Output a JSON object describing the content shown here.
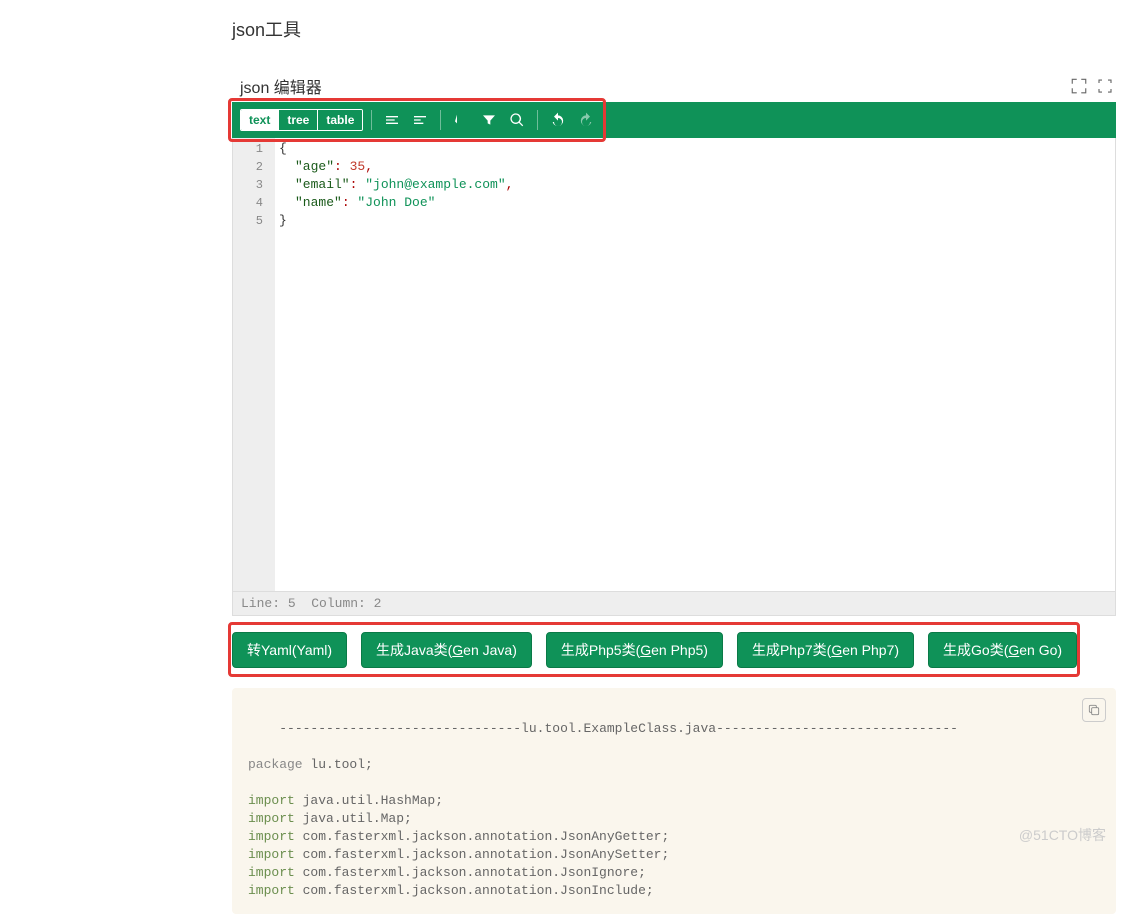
{
  "page_title": "json工具",
  "editor": {
    "title": "json 编辑器",
    "modes": {
      "text": "text",
      "tree": "tree",
      "table": "table",
      "active": "text"
    },
    "lines": [
      {
        "n": 1,
        "type": "brace-open",
        "text": "{"
      },
      {
        "n": 2,
        "type": "prop-num",
        "key": "\"age\"",
        "val": "35"
      },
      {
        "n": 3,
        "type": "prop-str",
        "key": "\"email\"",
        "val": "\"john@example.com\""
      },
      {
        "n": 4,
        "type": "prop-str-last",
        "key": "\"name\"",
        "val": "\"John Doe\""
      },
      {
        "n": 5,
        "type": "brace-close",
        "text": "}"
      }
    ],
    "status": {
      "line_label": "Line:",
      "line": "5",
      "col_label": "Column:",
      "col": "2"
    }
  },
  "actions": {
    "yaml": "转Yaml(Yaml)",
    "java_pre": "生成Java类(",
    "java_u": "G",
    "java_post": "en Java)",
    "php5_pre": "生成Php5类(",
    "php5_u": "G",
    "php5_post": "en Php5)",
    "php7_pre": "生成Php7类(",
    "php7_u": "G",
    "php7_post": "en Php7)",
    "go_pre": "生成Go类(",
    "go_u": "G",
    "go_post": "en Go)"
  },
  "output": {
    "header": "-------------------------------lu.tool.ExampleClass.java-------------------------------",
    "package_kw": "package",
    "package_rest": " lu.tool;",
    "import_kw": "import",
    "imports": [
      " java.util.HashMap;",
      " java.util.Map;",
      " com.fasterxml.jackson.annotation.JsonAnyGetter;",
      " com.fasterxml.jackson.annotation.JsonAnySetter;",
      " com.fasterxml.jackson.annotation.JsonIgnore;",
      " com.fasterxml.jackson.annotation.JsonInclude;"
    ]
  },
  "watermark": "@51CTO博客"
}
